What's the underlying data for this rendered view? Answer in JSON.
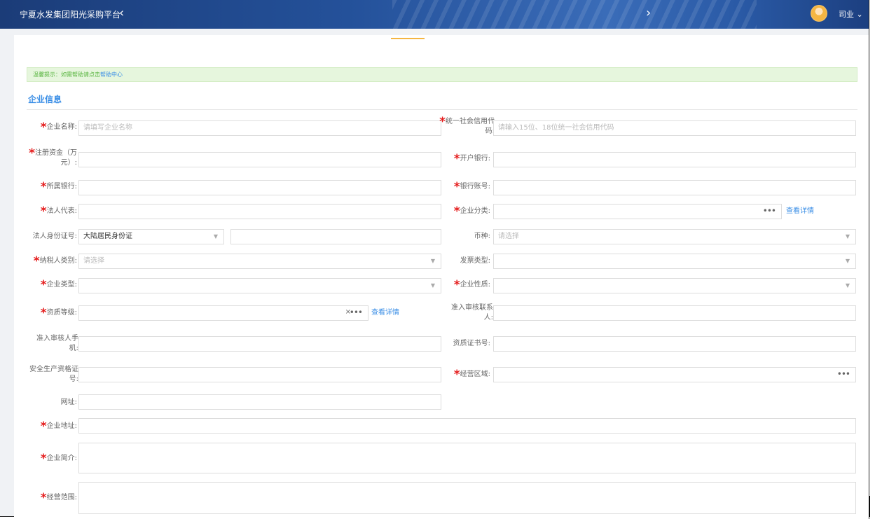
{
  "header": {
    "brand": "宁夏水发集团阳光采购平台",
    "nav_prev": "‹",
    "nav_next": "›",
    "username": "司业 ⌄"
  },
  "tip": {
    "prefix": "温馨提示：如需帮助请点击",
    "link": "帮助中心"
  },
  "section_title": "企业信息",
  "form": {
    "company_name": {
      "label": "企业名称:",
      "placeholder": "请填写企业名称"
    },
    "credit_code": {
      "label": "统一社会信用代码:",
      "placeholder": "请输入15位、18位统一社会信用代码"
    },
    "reg_capital": {
      "label": "注册资金（万元）:"
    },
    "bank": {
      "label": "开户银行:"
    },
    "parent_bank": {
      "label": "所属银行:"
    },
    "bank_account": {
      "label": "银行账号:"
    },
    "legal_rep": {
      "label": "法人代表:"
    },
    "category": {
      "label": "企业分类:",
      "detail": "查看详情"
    },
    "legal_id": {
      "label": "法人身份证号:",
      "type_value": "大陆居民身份证"
    },
    "currency": {
      "label": "币种:",
      "placeholder": "请选择"
    },
    "taxpayer_type": {
      "label": "纳税人类别:",
      "placeholder": "请选择"
    },
    "invoice_type": {
      "label": "发票类型:"
    },
    "company_type": {
      "label": "企业类型:"
    },
    "company_nature": {
      "label": "企业性质:"
    },
    "qualification": {
      "label": "资质等级:",
      "detail": "查看详情"
    },
    "audit_contact": {
      "label": "准入审核联系人:"
    },
    "audit_phone": {
      "label": "准入审核人手机:"
    },
    "cert_no": {
      "label": "资质证书号:"
    },
    "safety_cert": {
      "label": "安全生产资格证号:"
    },
    "business_area": {
      "label": "经营区域:"
    },
    "website": {
      "label": "网址:"
    },
    "address": {
      "label": "企业地址:"
    },
    "intro": {
      "label": "企业简介:"
    },
    "scope": {
      "label": "经营范围:"
    }
  }
}
